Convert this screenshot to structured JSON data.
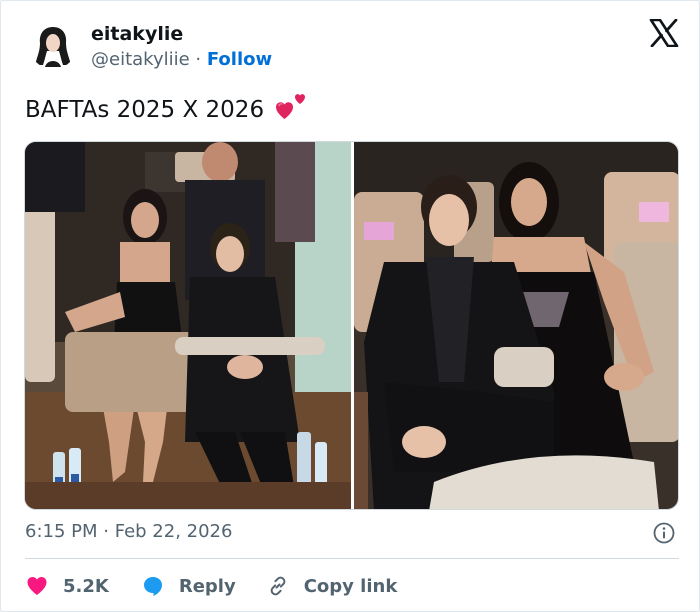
{
  "author": {
    "name": "eitakylie",
    "handle": "@eitakyliie",
    "separator": " · ",
    "follow_label": "Follow"
  },
  "tweet": {
    "text": "BAFTAs 2025 X 2026",
    "emoji_icon": "two-hearts-icon"
  },
  "timestamp": {
    "time": "6:15 PM",
    "separator": " · ",
    "date": "Feb 22, 2026"
  },
  "actions": {
    "likes": "5.2K",
    "reply_label": "Reply",
    "copy_link_label": "Copy link"
  },
  "icons": {
    "brand": "x-logo-icon",
    "info": "info-icon",
    "like": "heart-icon",
    "reply": "reply-bubble-icon",
    "copy": "link-icon"
  },
  "colors": {
    "follow": "#006fd6",
    "like": "#f91880",
    "reply": "#1d9bf0",
    "muted": "#536471",
    "text": "#0f1419"
  }
}
